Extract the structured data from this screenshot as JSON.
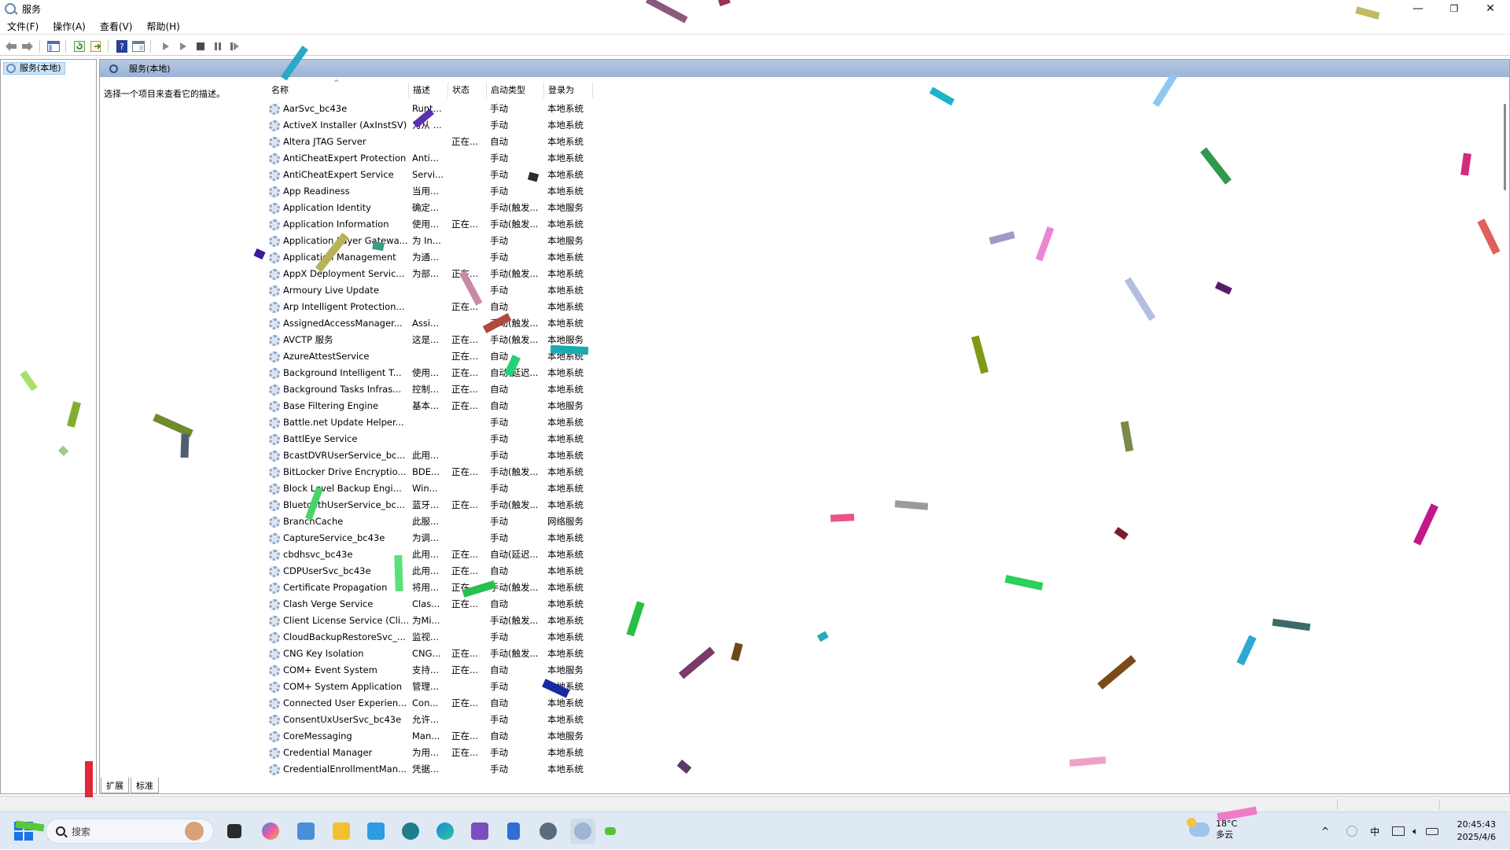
{
  "window": {
    "title": "服务",
    "minimize": "—",
    "restore": "❐",
    "close": "✕"
  },
  "menu": [
    "文件(F)",
    "操作(A)",
    "查看(V)",
    "帮助(H)"
  ],
  "toolbar_icons": [
    "back-icon",
    "forward-icon",
    "show-hide-console-tree-icon",
    "refresh-icon",
    "export-list-icon",
    "help-icon",
    "properties-icon",
    "start-service-icon",
    "start-service-alt-icon",
    "stop-service-icon",
    "pause-service-icon",
    "restart-service-icon"
  ],
  "tree": {
    "node_label": "服务(本地)"
  },
  "panel": {
    "header": "服务(本地)",
    "description": "选择一个项目来查看它的描述。"
  },
  "columns": [
    "名称",
    "描述",
    "状态",
    "启动类型",
    "登录为"
  ],
  "services": [
    [
      "AarSvc_bc43e",
      "Runt...",
      "",
      "手动",
      "本地系统"
    ],
    [
      "ActiveX Installer (AxInstSV)",
      "为从 ...",
      "",
      "手动",
      "本地系统"
    ],
    [
      "Altera JTAG Server",
      "",
      "正在...",
      "自动",
      "本地系统"
    ],
    [
      "AntiCheatExpert Protection",
      "Anti...",
      "",
      "手动",
      "本地系统"
    ],
    [
      "AntiCheatExpert Service",
      "Servi...",
      "",
      "手动",
      "本地系统"
    ],
    [
      "App Readiness",
      "当用...",
      "",
      "手动",
      "本地系统"
    ],
    [
      "Application Identity",
      "确定...",
      "",
      "手动(触发...",
      "本地服务"
    ],
    [
      "Application Information",
      "使用...",
      "正在...",
      "手动(触发...",
      "本地系统"
    ],
    [
      "Application Layer Gatewa...",
      "为 In...",
      "",
      "手动",
      "本地服务"
    ],
    [
      "Application Management",
      "为通...",
      "",
      "手动",
      "本地系统"
    ],
    [
      "AppX Deployment Servic...",
      "为部...",
      "正在...",
      "手动(触发...",
      "本地系统"
    ],
    [
      "Armoury Live Update",
      "",
      "",
      "手动",
      "本地系统"
    ],
    [
      "Arp Intelligent Protection...",
      "",
      "正在...",
      "自动",
      "本地系统"
    ],
    [
      "AssignedAccessManager...",
      "Assi...",
      "",
      "手动(触发...",
      "本地系统"
    ],
    [
      "AVCTP 服务",
      "这是...",
      "正在...",
      "手动(触发...",
      "本地服务"
    ],
    [
      "AzureAttestService",
      "",
      "正在...",
      "自动",
      "本地系统"
    ],
    [
      "Background Intelligent T...",
      "使用...",
      "正在...",
      "自动(延迟...",
      "本地系统"
    ],
    [
      "Background Tasks Infras...",
      "控制...",
      "正在...",
      "自动",
      "本地系统"
    ],
    [
      "Base Filtering Engine",
      "基本...",
      "正在...",
      "自动",
      "本地服务"
    ],
    [
      "Battle.net Update Helper...",
      "",
      "",
      "手动",
      "本地系统"
    ],
    [
      "BattlEye Service",
      "",
      "",
      "手动",
      "本地系统"
    ],
    [
      "BcastDVRUserService_bc...",
      "此用...",
      "",
      "手动",
      "本地系统"
    ],
    [
      "BitLocker Drive Encryptio...",
      "BDE...",
      "正在...",
      "手动(触发...",
      "本地系统"
    ],
    [
      "Block Level Backup Engi...",
      "Win...",
      "",
      "手动",
      "本地系统"
    ],
    [
      "BluetoothUserService_bc...",
      "蓝牙...",
      "正在...",
      "手动(触发...",
      "本地系统"
    ],
    [
      "BranchCache",
      "此服...",
      "",
      "手动",
      "网络服务"
    ],
    [
      "CaptureService_bc43e",
      "为调...",
      "",
      "手动",
      "本地系统"
    ],
    [
      "cbdhsvc_bc43e",
      "此用...",
      "正在...",
      "自动(延迟...",
      "本地系统"
    ],
    [
      "CDPUserSvc_bc43e",
      "此用...",
      "正在...",
      "自动",
      "本地系统"
    ],
    [
      "Certificate Propagation",
      "将用...",
      "正在...",
      "手动(触发...",
      "本地系统"
    ],
    [
      "Clash Verge Service",
      "Clas...",
      "正在...",
      "自动",
      "本地系统"
    ],
    [
      "Client License Service (Cli...",
      "为Mi...",
      "",
      "手动(触发...",
      "本地系统"
    ],
    [
      "CloudBackupRestoreSvc_...",
      "监视...",
      "",
      "手动",
      "本地系统"
    ],
    [
      "CNG Key Isolation",
      "CNG...",
      "正在...",
      "手动(触发...",
      "本地系统"
    ],
    [
      "COM+ Event System",
      "支持...",
      "正在...",
      "自动",
      "本地服务"
    ],
    [
      "COM+ System Application",
      "管理...",
      "",
      "手动",
      "本地系统"
    ],
    [
      "Connected User Experien...",
      "Con...",
      "正在...",
      "自动",
      "本地系统"
    ],
    [
      "ConsentUxUserSvc_bc43e",
      "允许...",
      "",
      "手动",
      "本地系统"
    ],
    [
      "CoreMessaging",
      "Man...",
      "正在...",
      "自动",
      "本地服务"
    ],
    [
      "Credential Manager",
      "为用...",
      "正在...",
      "手动",
      "本地系统"
    ],
    [
      "CredentialEnrollmentMan...",
      "凭据...",
      "",
      "手动",
      "本地系统"
    ]
  ],
  "tabs": [
    "扩展",
    "标准"
  ],
  "taskbar": {
    "search_placeholder": "搜索",
    "apps": [
      "file-explorer-window-icon",
      "copilot-icon",
      "remote-desktop-icon",
      "file-explorer-icon",
      "calendar-app-icon",
      "store-app-icon",
      "edge-icon",
      "visual-studio-icon",
      "notepad-icon",
      "settings-icon",
      "services-app-icon",
      "terminal-icon"
    ],
    "weather": {
      "temp": "18°C",
      "condition": "多云"
    },
    "tray": {
      "ime": "中"
    },
    "clock": {
      "time": "20:45:43",
      "date": "2025/4/6"
    }
  }
}
